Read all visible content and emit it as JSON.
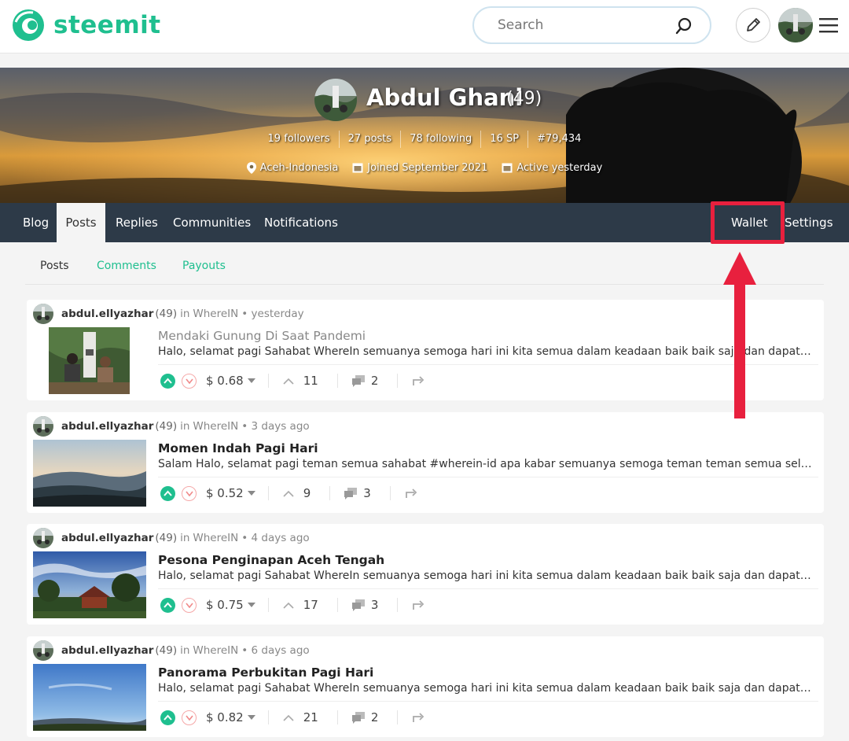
{
  "header": {
    "logo_text": "steemit",
    "search_placeholder": "Search",
    "brand_color": "#1fbf8f"
  },
  "profile": {
    "name": "Abdul Ghani",
    "reputation": "(49)",
    "stats": [
      "19 followers",
      "27 posts",
      "78 following",
      "16 SP",
      "#79,434"
    ],
    "location": "Aceh-Indonesia",
    "joined": "Joined September 2021",
    "active": "Active yesterday"
  },
  "nav": {
    "blog": "Blog",
    "posts": "Posts",
    "replies": "Replies",
    "communities": "Communities",
    "notifications": "Notifications",
    "wallet": "Wallet",
    "settings": "Settings"
  },
  "subtabs": {
    "posts": "Posts",
    "comments": "Comments",
    "payouts": "Payouts"
  },
  "posts": [
    {
      "author": "abdul.ellyazhar",
      "rep": "(49)",
      "in": "in",
      "community": "WhereIN",
      "time": "• yesterday",
      "title": "Mendaki Gunung Di Saat Pandemi",
      "body": "Halo, selamat pagi Sahabat WhereIn semuanya semoga hari ini kita semua dalam keadaan baik baik saja dan dapat…",
      "payout": "$ 0.68",
      "votes": "11",
      "comments": "2"
    },
    {
      "author": "abdul.ellyazhar",
      "rep": "(49)",
      "in": "in",
      "community": "WhereIN",
      "time": "• 3 days ago",
      "title": "Momen Indah Pagi Hari",
      "body": "Salam Halo, selamat pagi teman semua sahabat #wherein-id apa kabar semuanya semoga teman teman semua selalu di beri…",
      "payout": "$ 0.52",
      "votes": "9",
      "comments": "3"
    },
    {
      "author": "abdul.ellyazhar",
      "rep": "(49)",
      "in": "in",
      "community": "WhereIN",
      "time": "• 4 days ago",
      "title": "Pesona Penginapan Aceh Tengah",
      "body": "Halo, selamat pagi Sahabat WhereIn semuanya semoga hari ini kita semua dalam keadaan baik baik saja dan dapat…",
      "payout": "$ 0.75",
      "votes": "17",
      "comments": "3"
    },
    {
      "author": "abdul.ellyazhar",
      "rep": "(49)",
      "in": "in",
      "community": "WhereIN",
      "time": "• 6 days ago",
      "title": "Panorama Perbukitan Pagi Hari",
      "body": "Halo, selamat pagi Sahabat WhereIn semuanya semoga hari ini kita semua dalam keadaan baik baik saja dan dapat…",
      "payout": "$ 0.82",
      "votes": "21",
      "comments": "2"
    }
  ],
  "annotation_color": "#e8203e"
}
